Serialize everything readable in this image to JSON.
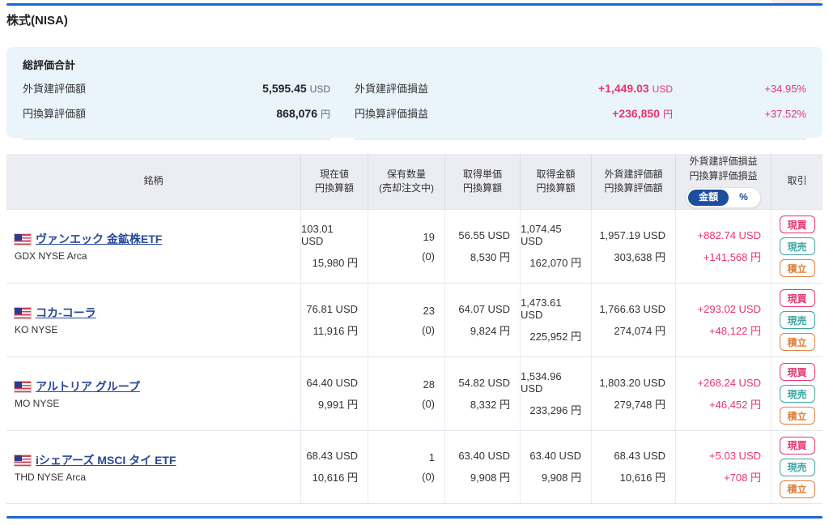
{
  "page": {
    "title": "株式(NISA)"
  },
  "colors": {
    "accent_blue": "#1a65d8",
    "gain_pink": "#e5356f",
    "link_blue": "#27489a",
    "toggle_blue": "#1c4e9d",
    "sell_teal": "#3aa6a1",
    "tsumitate_orange": "#e0813c",
    "summary_bg": "#e9f4fb",
    "header_bg": "#ecedf3"
  },
  "summary": {
    "title": "総評価合計",
    "items": [
      {
        "label": "外貨建評価額",
        "value": "5,595.45",
        "unit": "USD"
      },
      {
        "label": "円換算評価額",
        "value": "868,076",
        "unit": "円"
      },
      {
        "label": "外貨建評価損益",
        "value": "+1,449.03",
        "unit": "USD",
        "pct": "+34.95%"
      },
      {
        "label": "円換算評価損益",
        "value": "+236,850",
        "unit": "円",
        "pct": "+37.52%"
      }
    ]
  },
  "table": {
    "headers": [
      {
        "line1": "銘柄",
        "line2": ""
      },
      {
        "line1": "現在値",
        "line2": "円換算額"
      },
      {
        "line1": "保有数量",
        "line2": "(売却注文中)"
      },
      {
        "line1": "取得単価",
        "line2": "円換算額"
      },
      {
        "line1": "取得金額",
        "line2": "円換算額"
      },
      {
        "line1": "外貨建評価額",
        "line2": "円換算評価額"
      },
      {
        "line1": "外貨建評価損益",
        "line2": "円換算評価損益"
      },
      {
        "line1": "取引",
        "line2": ""
      }
    ],
    "toggle": {
      "amount": "金額",
      "percent": "%"
    },
    "actions": {
      "buy": "現買",
      "sell": "現売",
      "tsumitate": "積立"
    },
    "rows": [
      {
        "name": "ヴァンエック 金鉱株ETF",
        "ticker": "GDX NYSE Arca",
        "current_usd": "103.01 USD",
        "current_jpy": "15,980 円",
        "qty": "19",
        "qty_sub": "(0)",
        "unit_usd": "56.55 USD",
        "unit_jpy": "8,530 円",
        "cost_usd": "1,074.45 USD",
        "cost_jpy": "162,070 円",
        "eval_usd": "1,957.19 USD",
        "eval_jpy": "303,638 円",
        "pl_usd": "+882.74 USD",
        "pl_jpy": "+141,568 円"
      },
      {
        "name": "コカ-コーラ",
        "ticker": "KO NYSE",
        "current_usd": "76.81 USD",
        "current_jpy": "11,916 円",
        "qty": "23",
        "qty_sub": "(0)",
        "unit_usd": "64.07 USD",
        "unit_jpy": "9,824 円",
        "cost_usd": "1,473.61 USD",
        "cost_jpy": "225,952 円",
        "eval_usd": "1,766.63 USD",
        "eval_jpy": "274,074 円",
        "pl_usd": "+293.02 USD",
        "pl_jpy": "+48,122 円"
      },
      {
        "name": "アルトリア グループ",
        "ticker": "MO NYSE",
        "current_usd": "64.40 USD",
        "current_jpy": "9,991 円",
        "qty": "28",
        "qty_sub": "(0)",
        "unit_usd": "54.82 USD",
        "unit_jpy": "8,332 円",
        "cost_usd": "1,534.96 USD",
        "cost_jpy": "233,296 円",
        "eval_usd": "1,803.20 USD",
        "eval_jpy": "279,748 円",
        "pl_usd": "+268.24 USD",
        "pl_jpy": "+46,452 円"
      },
      {
        "name": "iシェアーズ MSCI タイ ETF",
        "ticker": "THD NYSE Arca",
        "current_usd": "68.43 USD",
        "current_jpy": "10,616 円",
        "qty": "1",
        "qty_sub": "(0)",
        "unit_usd": "63.40 USD",
        "unit_jpy": "9,908 円",
        "cost_usd": "63.40 USD",
        "cost_jpy": "9,908 円",
        "eval_usd": "68.43 USD",
        "eval_jpy": "10,616 円",
        "pl_usd": "+5.03 USD",
        "pl_jpy": "+708 円"
      }
    ]
  }
}
